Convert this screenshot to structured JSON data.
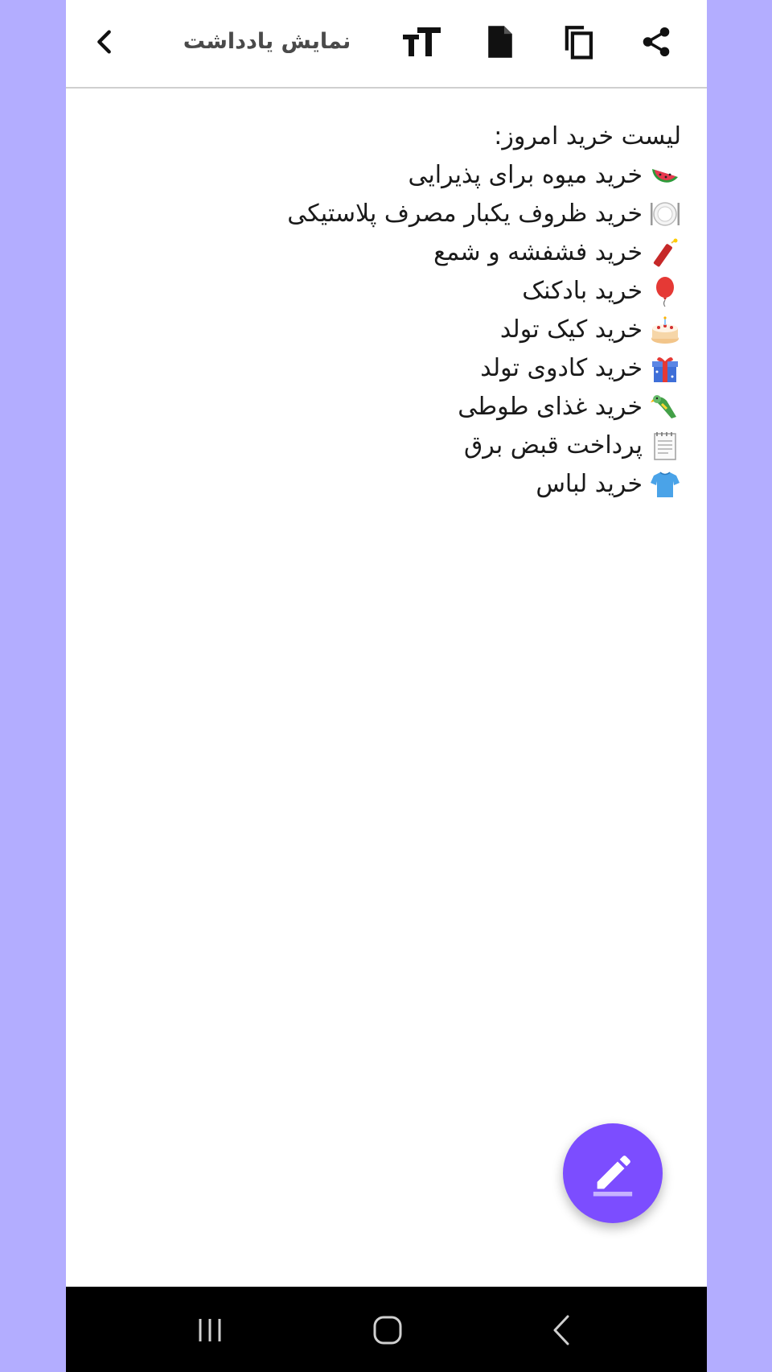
{
  "toolbar": {
    "title": "نمایش یادداشت"
  },
  "note": {
    "heading": "لیست خرید امروز:",
    "items": [
      {
        "icon": "watermelon-icon",
        "text": "خرید میوه برای پذیرایی"
      },
      {
        "icon": "plate-icon",
        "text": "خرید ظروف یکبار مصرف پلاستیکی"
      },
      {
        "icon": "firecracker-icon",
        "text": "خرید فشفشه و شمع"
      },
      {
        "icon": "balloon-icon",
        "text": "خرید بادکنک"
      },
      {
        "icon": "birthday-cake-icon",
        "text": "خرید کیک تولد"
      },
      {
        "icon": "gift-icon",
        "text": "خرید کادوی تولد"
      },
      {
        "icon": "parrot-icon",
        "text": "خرید غذای طوطی"
      },
      {
        "icon": "notepad-icon",
        "text": "پرداخت قبض برق"
      },
      {
        "icon": "tshirt-icon",
        "text": "خرید لباس"
      }
    ]
  },
  "colors": {
    "background": "#b3adff",
    "fab": "#7c4dff",
    "title_text": "#4a4a4a",
    "navbar": "#000000"
  }
}
